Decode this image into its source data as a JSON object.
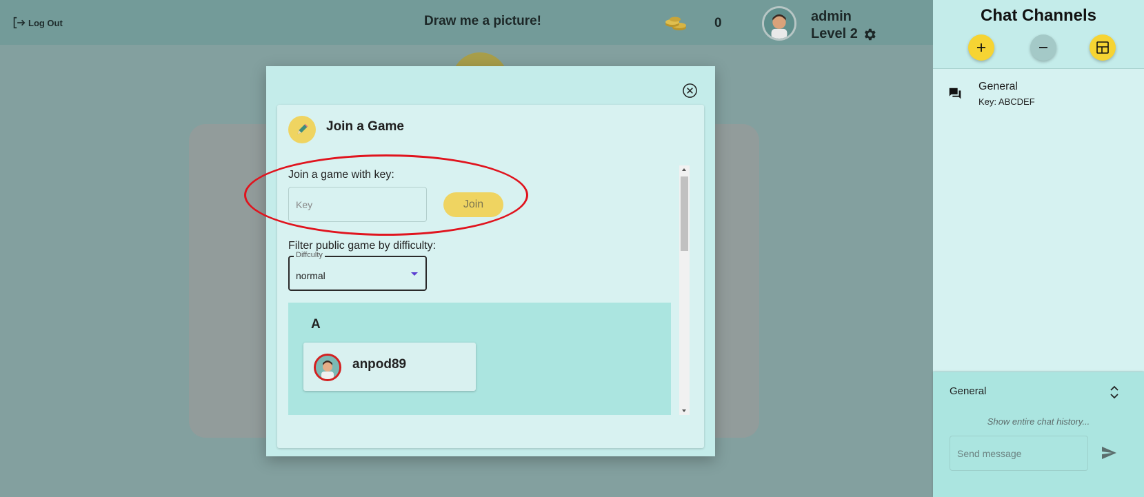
{
  "header": {
    "logout_label": "Log Out",
    "title": "Draw me a picture!",
    "coins": "0",
    "username": "admin",
    "level": "Level 2"
  },
  "modal": {
    "title": "Join a Game",
    "key_label": "Join a game with key:",
    "key_placeholder": "Key",
    "key_value": "",
    "join_label": "Join",
    "filter_label": "Filter public game by difficulty:",
    "difficulty_legend": "Diffculty",
    "difficulty_value": "normal",
    "groups": [
      {
        "letter": "A",
        "players": [
          "anpod89"
        ]
      }
    ]
  },
  "sidebar": {
    "title": "Chat Channels",
    "channels": [
      {
        "name": "General",
        "key": "Key: ABCDEF"
      }
    ],
    "chat": {
      "channel_name": "General",
      "history_link": "Show entire chat history...",
      "message_placeholder": "Send message"
    }
  },
  "colors": {
    "accent_yellow": "#f6d433",
    "panel_cyan": "#c4ecea",
    "annotation_red": "#e0141e"
  },
  "icons": [
    "logout-icon",
    "coins-icon",
    "gear-icon",
    "close-icon",
    "pencil-icon",
    "forum-icon",
    "plus-icon",
    "minus-icon",
    "layout-icon",
    "expand-icon",
    "send-icon"
  ]
}
